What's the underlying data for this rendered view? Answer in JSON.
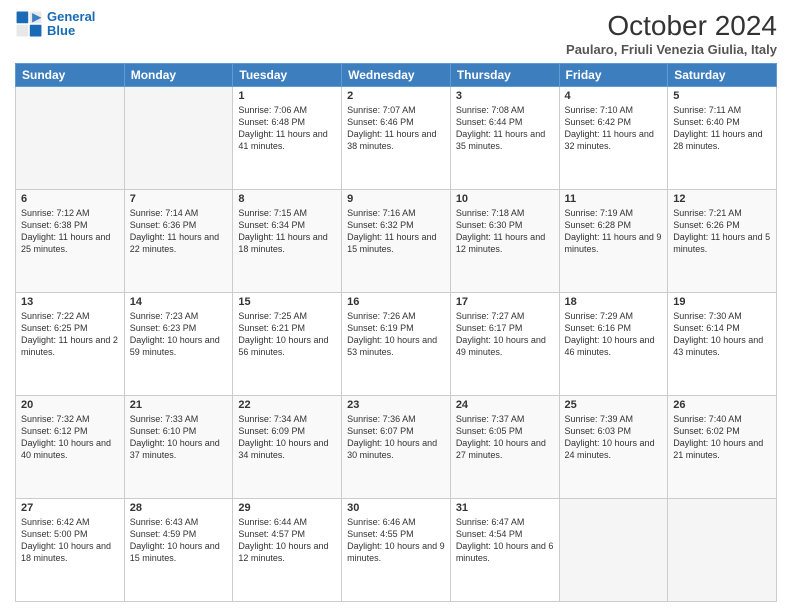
{
  "logo": {
    "line1": "General",
    "line2": "Blue"
  },
  "title": "October 2024",
  "subtitle": "Paularo, Friuli Venezia Giulia, Italy",
  "days_of_week": [
    "Sunday",
    "Monday",
    "Tuesday",
    "Wednesday",
    "Thursday",
    "Friday",
    "Saturday"
  ],
  "weeks": [
    [
      {
        "day": "",
        "info": ""
      },
      {
        "day": "",
        "info": ""
      },
      {
        "day": "1",
        "info": "Sunrise: 7:06 AM\nSunset: 6:48 PM\nDaylight: 11 hours and 41 minutes."
      },
      {
        "day": "2",
        "info": "Sunrise: 7:07 AM\nSunset: 6:46 PM\nDaylight: 11 hours and 38 minutes."
      },
      {
        "day": "3",
        "info": "Sunrise: 7:08 AM\nSunset: 6:44 PM\nDaylight: 11 hours and 35 minutes."
      },
      {
        "day": "4",
        "info": "Sunrise: 7:10 AM\nSunset: 6:42 PM\nDaylight: 11 hours and 32 minutes."
      },
      {
        "day": "5",
        "info": "Sunrise: 7:11 AM\nSunset: 6:40 PM\nDaylight: 11 hours and 28 minutes."
      }
    ],
    [
      {
        "day": "6",
        "info": "Sunrise: 7:12 AM\nSunset: 6:38 PM\nDaylight: 11 hours and 25 minutes."
      },
      {
        "day": "7",
        "info": "Sunrise: 7:14 AM\nSunset: 6:36 PM\nDaylight: 11 hours and 22 minutes."
      },
      {
        "day": "8",
        "info": "Sunrise: 7:15 AM\nSunset: 6:34 PM\nDaylight: 11 hours and 18 minutes."
      },
      {
        "day": "9",
        "info": "Sunrise: 7:16 AM\nSunset: 6:32 PM\nDaylight: 11 hours and 15 minutes."
      },
      {
        "day": "10",
        "info": "Sunrise: 7:18 AM\nSunset: 6:30 PM\nDaylight: 11 hours and 12 minutes."
      },
      {
        "day": "11",
        "info": "Sunrise: 7:19 AM\nSunset: 6:28 PM\nDaylight: 11 hours and 9 minutes."
      },
      {
        "day": "12",
        "info": "Sunrise: 7:21 AM\nSunset: 6:26 PM\nDaylight: 11 hours and 5 minutes."
      }
    ],
    [
      {
        "day": "13",
        "info": "Sunrise: 7:22 AM\nSunset: 6:25 PM\nDaylight: 11 hours and 2 minutes."
      },
      {
        "day": "14",
        "info": "Sunrise: 7:23 AM\nSunset: 6:23 PM\nDaylight: 10 hours and 59 minutes."
      },
      {
        "day": "15",
        "info": "Sunrise: 7:25 AM\nSunset: 6:21 PM\nDaylight: 10 hours and 56 minutes."
      },
      {
        "day": "16",
        "info": "Sunrise: 7:26 AM\nSunset: 6:19 PM\nDaylight: 10 hours and 53 minutes."
      },
      {
        "day": "17",
        "info": "Sunrise: 7:27 AM\nSunset: 6:17 PM\nDaylight: 10 hours and 49 minutes."
      },
      {
        "day": "18",
        "info": "Sunrise: 7:29 AM\nSunset: 6:16 PM\nDaylight: 10 hours and 46 minutes."
      },
      {
        "day": "19",
        "info": "Sunrise: 7:30 AM\nSunset: 6:14 PM\nDaylight: 10 hours and 43 minutes."
      }
    ],
    [
      {
        "day": "20",
        "info": "Sunrise: 7:32 AM\nSunset: 6:12 PM\nDaylight: 10 hours and 40 minutes."
      },
      {
        "day": "21",
        "info": "Sunrise: 7:33 AM\nSunset: 6:10 PM\nDaylight: 10 hours and 37 minutes."
      },
      {
        "day": "22",
        "info": "Sunrise: 7:34 AM\nSunset: 6:09 PM\nDaylight: 10 hours and 34 minutes."
      },
      {
        "day": "23",
        "info": "Sunrise: 7:36 AM\nSunset: 6:07 PM\nDaylight: 10 hours and 30 minutes."
      },
      {
        "day": "24",
        "info": "Sunrise: 7:37 AM\nSunset: 6:05 PM\nDaylight: 10 hours and 27 minutes."
      },
      {
        "day": "25",
        "info": "Sunrise: 7:39 AM\nSunset: 6:03 PM\nDaylight: 10 hours and 24 minutes."
      },
      {
        "day": "26",
        "info": "Sunrise: 7:40 AM\nSunset: 6:02 PM\nDaylight: 10 hours and 21 minutes."
      }
    ],
    [
      {
        "day": "27",
        "info": "Sunrise: 6:42 AM\nSunset: 5:00 PM\nDaylight: 10 hours and 18 minutes."
      },
      {
        "day": "28",
        "info": "Sunrise: 6:43 AM\nSunset: 4:59 PM\nDaylight: 10 hours and 15 minutes."
      },
      {
        "day": "29",
        "info": "Sunrise: 6:44 AM\nSunset: 4:57 PM\nDaylight: 10 hours and 12 minutes."
      },
      {
        "day": "30",
        "info": "Sunrise: 6:46 AM\nSunset: 4:55 PM\nDaylight: 10 hours and 9 minutes."
      },
      {
        "day": "31",
        "info": "Sunrise: 6:47 AM\nSunset: 4:54 PM\nDaylight: 10 hours and 6 minutes."
      },
      {
        "day": "",
        "info": ""
      },
      {
        "day": "",
        "info": ""
      }
    ]
  ]
}
